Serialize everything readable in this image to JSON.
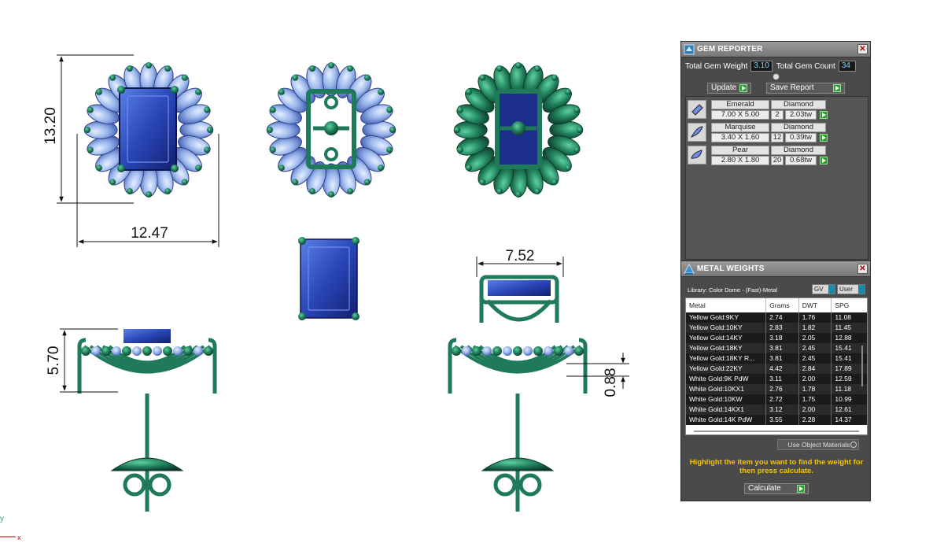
{
  "viewport": {
    "dimensions": {
      "top_height": "13.20",
      "top_width": "12.47",
      "stone_width": "7.52",
      "side_height": "5.70",
      "side_offset": "0.88"
    },
    "axis_labels": {
      "y": "y",
      "x": "x"
    },
    "colors": {
      "metal": "#1f7a5a",
      "metal_light": "#3aa57c",
      "stone_blue": "#2a46b8",
      "petal": "#9bb7ec"
    }
  },
  "gem_reporter": {
    "title": "GEM REPORTER",
    "total_weight_label": "Total Gem Weight",
    "total_weight_value": "3.10",
    "total_count_label": "Total Gem Count",
    "total_count_value": "34",
    "update_label": "Update",
    "save_label": "Save Report",
    "gems": [
      {
        "shape": "Emerald",
        "type": "Diamond",
        "size": "7.00 X 5.00",
        "qty": "2",
        "weight": "2.03tw"
      },
      {
        "shape": "Marquise",
        "type": "Diamond",
        "size": "3.40 X 1.60",
        "qty": "12",
        "weight": "0.39tw"
      },
      {
        "shape": "Pear",
        "type": "Diamond",
        "size": "2.80 X 1.80",
        "qty": "20",
        "weight": "0.68tw"
      }
    ]
  },
  "metal_weights": {
    "title": "METAL WEIGHTS",
    "library_label": "Library: Color Dome - (Fast)-Metal",
    "unit_select": "GV",
    "user_select": "User",
    "headers": {
      "metal": "Metal",
      "grams": "Grams",
      "dwt": "DWT",
      "spg": "SPG"
    },
    "rows": [
      {
        "metal": "Yellow Gold:9KY",
        "grams": "2.74",
        "dwt": "1.76",
        "spg": "11.08"
      },
      {
        "metal": "Yellow Gold:10KY",
        "grams": "2.83",
        "dwt": "1.82",
        "spg": "11.45"
      },
      {
        "metal": "Yellow Gold:14KY",
        "grams": "3.18",
        "dwt": "2.05",
        "spg": "12.88"
      },
      {
        "metal": "Yellow Gold:18KY",
        "grams": "3.81",
        "dwt": "2.45",
        "spg": "15.41"
      },
      {
        "metal": "Yellow Gold:18KY R...",
        "grams": "3.81",
        "dwt": "2.45",
        "spg": "15.41"
      },
      {
        "metal": "Yellow Gold:22KY",
        "grams": "4.42",
        "dwt": "2.84",
        "spg": "17.89"
      },
      {
        "metal": "White Gold:9K PdW",
        "grams": "3.11",
        "dwt": "2.00",
        "spg": "12.59"
      },
      {
        "metal": "White Gold:10KX1",
        "grams": "2.76",
        "dwt": "1.78",
        "spg": "11.18"
      },
      {
        "metal": "White Gold:10KW",
        "grams": "2.72",
        "dwt": "1.75",
        "spg": "10.99"
      },
      {
        "metal": "White Gold:14KX1",
        "grams": "3.12",
        "dwt": "2.00",
        "spg": "12.61"
      },
      {
        "metal": "White Gold:14K PdW",
        "grams": "3.55",
        "dwt": "2.28",
        "spg": "14.37"
      }
    ],
    "use_object_materials_label": "Use Object Materials",
    "hint": "Highlight the item you want to find the weight for then press calculate.",
    "calculate_label": "Calculate"
  }
}
